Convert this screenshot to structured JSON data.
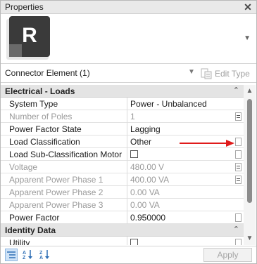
{
  "window": {
    "title": "Properties",
    "close_icon": "close-icon"
  },
  "type_selector": {
    "logo_letter": "R",
    "dropdown_icon": "dropdown-arrow-icon"
  },
  "element_selector": {
    "label": "Connector Element (1)",
    "edit_type_label": "Edit Type"
  },
  "groups": [
    {
      "name": "Electrical - Loads",
      "rows": [
        {
          "name": "System Type",
          "value": "Power - Unbalanced",
          "enabled": true,
          "button": "none"
        },
        {
          "name": "Number of Poles",
          "value": "1",
          "enabled": false,
          "button": "eq"
        },
        {
          "name": "Power Factor State",
          "value": "Lagging",
          "enabled": true,
          "button": "none"
        },
        {
          "name": "Load Classification",
          "value": "Other",
          "enabled": true,
          "button": "plain"
        },
        {
          "name": "Load Sub-Classification Motor",
          "value": "",
          "enabled": true,
          "button": "plain",
          "checkbox": true,
          "checked": false
        },
        {
          "name": "Voltage",
          "value": "480.00 V",
          "enabled": false,
          "button": "eq"
        },
        {
          "name": "Apparent Power Phase 1",
          "value": "400.00 VA",
          "enabled": false,
          "button": "eq"
        },
        {
          "name": "Apparent Power Phase 2",
          "value": "0.00 VA",
          "enabled": false,
          "button": "none"
        },
        {
          "name": "Apparent Power Phase 3",
          "value": "0.00 VA",
          "enabled": false,
          "button": "none"
        },
        {
          "name": "Power Factor",
          "value": "0.950000",
          "enabled": true,
          "button": "plain"
        }
      ]
    },
    {
      "name": "Identity Data",
      "rows": [
        {
          "name": "Utility",
          "value": "",
          "enabled": true,
          "button": "plain",
          "checkbox": true,
          "checked": false
        }
      ]
    }
  ],
  "footer": {
    "apply_label": "Apply"
  },
  "colors": {
    "annotation_arrow": "#e01b1b",
    "group_header_bg": "#e4e4e4",
    "disabled_text": "#9a9a9a"
  }
}
